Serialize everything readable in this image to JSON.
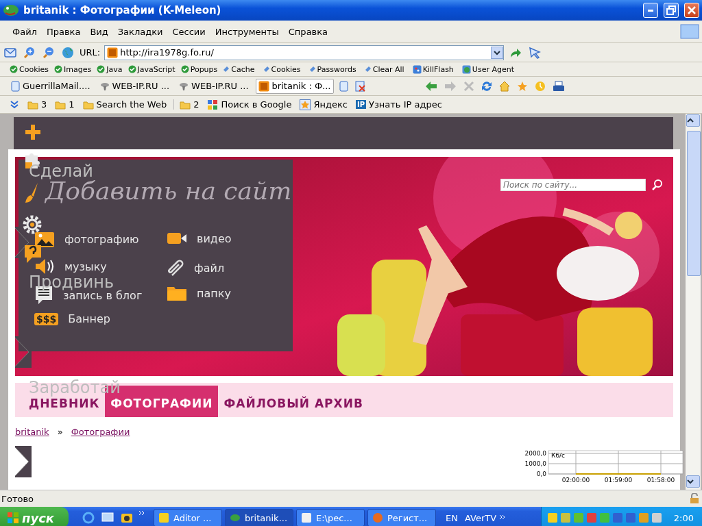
{
  "window": {
    "title": "britanik : Фотографии (K-Meleon)"
  },
  "menu": [
    {
      "label": "Файл"
    },
    {
      "label": "Правка"
    },
    {
      "label": "Вид"
    },
    {
      "label": "Закладки"
    },
    {
      "label": "Сессии"
    },
    {
      "label": "Инструменты"
    },
    {
      "label": "Справка"
    }
  ],
  "toolbar": {
    "url_label": "URL:",
    "url": "http://ira1978g.fo.ru/"
  },
  "privacy_bar": [
    {
      "label": "Cookies",
      "kind": "check"
    },
    {
      "label": "Images",
      "kind": "check"
    },
    {
      "label": "Java",
      "kind": "check"
    },
    {
      "label": "JavaScript",
      "kind": "check"
    },
    {
      "label": "Popups",
      "kind": "check"
    },
    {
      "label": "Cache",
      "kind": "clear"
    },
    {
      "label": "Cookies",
      "kind": "clear"
    },
    {
      "label": "Passwords",
      "kind": "clear"
    },
    {
      "label": "Clear All",
      "kind": "clear"
    },
    {
      "label": "KillFlash",
      "kind": "flash"
    },
    {
      "label": "User Agent",
      "kind": "agent"
    }
  ],
  "tabs": [
    {
      "label": "GuerrillaMail....",
      "kind": "page",
      "selected": false
    },
    {
      "label": "WEB-IP.RU ...",
      "kind": "alien",
      "selected": false
    },
    {
      "label": "WEB-IP.RU ...",
      "kind": "alien",
      "selected": false
    },
    {
      "label": "britanik : Ф...",
      "kind": "site",
      "selected": true
    }
  ],
  "bookmarks": [
    {
      "kind": "folder",
      "label": "3"
    },
    {
      "kind": "folder",
      "label": "1"
    },
    {
      "kind": "folder",
      "label": "Search the Web"
    },
    {
      "kind": "folder",
      "label": "2"
    },
    {
      "kind": "google",
      "label": "Поиск в Google"
    },
    {
      "kind": "yandex",
      "label": "Яндекс"
    },
    {
      "kind": "ip",
      "label": "Узнать IP адрес",
      "badge": "IP"
    }
  ],
  "page": {
    "side_labels": [
      "Сделай",
      "Продвинь",
      "Заработай"
    ],
    "search": {
      "placeholder": "Поиск по сайту..."
    },
    "add_menu": {
      "title": "Добавить на сайт",
      "items": [
        {
          "label": "фотографию"
        },
        {
          "kind": "video",
          "label": "видео"
        },
        {
          "kind": "music",
          "label": "музыку"
        },
        {
          "kind": "file",
          "label": "файл"
        },
        {
          "kind": "blog",
          "label": "запись в блог"
        },
        {
          "kind": "folder",
          "label": "папку"
        },
        {
          "kind": "banner",
          "label": "Баннер",
          "badge": "$$$"
        }
      ]
    },
    "nav": [
      {
        "label": "ДНЕВНИК",
        "selected": false
      },
      {
        "label": "ФОТОГРАФИИ",
        "selected": true
      },
      {
        "label": "ФАЙЛОВЫЙ АРХИВ",
        "selected": false
      }
    ],
    "breadcrumb": {
      "items": [
        "britanik",
        "Фотографии"
      ],
      "separator": "»"
    }
  },
  "net_monitor": {
    "chart_data": {
      "type": "line",
      "ylabel": "Кб/с",
      "categories": [
        "02:00:00",
        "01:59:00",
        "01:58:00"
      ],
      "series": [
        {
          "color": "#c8a000",
          "values": [
            0,
            0,
            0
          ]
        }
      ],
      "grid": true,
      "ylim": [
        0,
        2000
      ],
      "yticks": [
        {
          "value": 0,
          "label": "0,0"
        },
        {
          "value": 1000,
          "label": "1000,0"
        },
        {
          "value": 2000,
          "label": "2000,0"
        }
      ]
    }
  },
  "status_bar": {
    "text": "Готово"
  },
  "taskbar": {
    "start": "пуск",
    "tasks": [
      {
        "label": "Aditor ...",
        "kind": "aditor",
        "selected": false
      },
      {
        "label": "britanik...",
        "kind": "meleon",
        "selected": true
      },
      {
        "label": "E:\\рес...",
        "kind": "notepad",
        "selected": false
      },
      {
        "label": "Регист...",
        "kind": "firefox",
        "selected": false
      }
    ],
    "language": "EN",
    "toolbar_label": "AVerTV",
    "clock": "2:00"
  }
}
